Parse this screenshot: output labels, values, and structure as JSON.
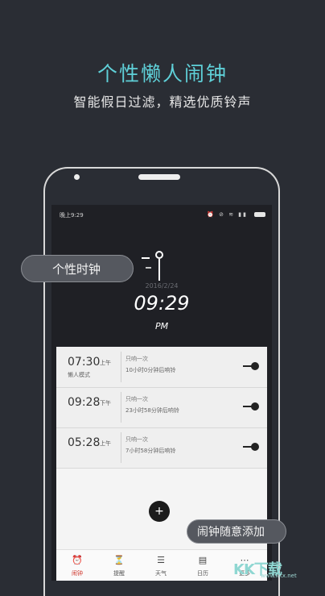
{
  "promo": {
    "title": "个性懒人闹钟",
    "subtitle": "智能假日过滤，精选优质铃声"
  },
  "statusbar": {
    "time": "晚上9:29",
    "icons": "⏰ ⊘ ≋ ▮▮"
  },
  "clock": {
    "date": "2016/2/24",
    "time": "09:29",
    "ampm": "PM"
  },
  "alarms": [
    {
      "time": "07:30",
      "ampm": "上午",
      "mode": "懒人模式",
      "repeat": "只响一次",
      "remaining": "10小时0分钟后响铃"
    },
    {
      "time": "09:28",
      "ampm": "下午",
      "mode": "",
      "repeat": "只响一次",
      "remaining": "23小时58分钟后响铃"
    },
    {
      "time": "05:28",
      "ampm": "上午",
      "mode": "",
      "repeat": "只响一次",
      "remaining": "7小时58分钟后响铃"
    }
  ],
  "fab": {
    "label": "+"
  },
  "tabs": [
    {
      "label": "闹钟",
      "icon": "⏰"
    },
    {
      "label": "提醒",
      "icon": "⏳"
    },
    {
      "label": "天气",
      "icon": "☰"
    },
    {
      "label": "日历",
      "icon": "▤"
    },
    {
      "label": "更多",
      "icon": "⋯"
    }
  ],
  "callouts": {
    "clock_style": "个性时钟",
    "add_alarm": "闹钟随意添加"
  },
  "watermark": {
    "text": "KK下载",
    "url": "www.kkx.net"
  },
  "colors": {
    "background": "#2a2d34",
    "accent": "#5fd0d8",
    "active_tab": "#d03a30"
  }
}
